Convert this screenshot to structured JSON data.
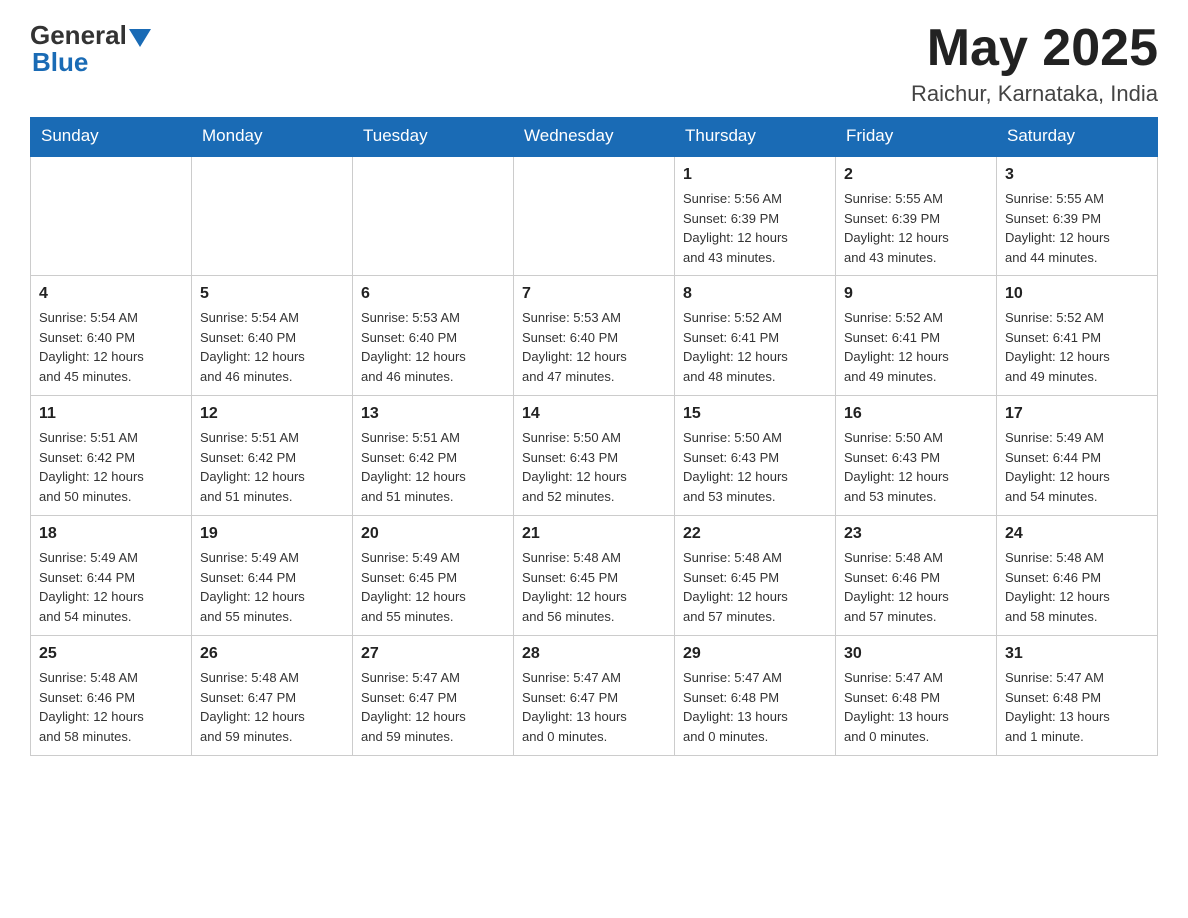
{
  "header": {
    "logo_general": "General",
    "logo_blue": "Blue",
    "month_title": "May 2025",
    "location": "Raichur, Karnataka, India"
  },
  "weekdays": [
    "Sunday",
    "Monday",
    "Tuesday",
    "Wednesday",
    "Thursday",
    "Friday",
    "Saturday"
  ],
  "weeks": [
    [
      {
        "day": "",
        "info": ""
      },
      {
        "day": "",
        "info": ""
      },
      {
        "day": "",
        "info": ""
      },
      {
        "day": "",
        "info": ""
      },
      {
        "day": "1",
        "info": "Sunrise: 5:56 AM\nSunset: 6:39 PM\nDaylight: 12 hours\nand 43 minutes."
      },
      {
        "day": "2",
        "info": "Sunrise: 5:55 AM\nSunset: 6:39 PM\nDaylight: 12 hours\nand 43 minutes."
      },
      {
        "day": "3",
        "info": "Sunrise: 5:55 AM\nSunset: 6:39 PM\nDaylight: 12 hours\nand 44 minutes."
      }
    ],
    [
      {
        "day": "4",
        "info": "Sunrise: 5:54 AM\nSunset: 6:40 PM\nDaylight: 12 hours\nand 45 minutes."
      },
      {
        "day": "5",
        "info": "Sunrise: 5:54 AM\nSunset: 6:40 PM\nDaylight: 12 hours\nand 46 minutes."
      },
      {
        "day": "6",
        "info": "Sunrise: 5:53 AM\nSunset: 6:40 PM\nDaylight: 12 hours\nand 46 minutes."
      },
      {
        "day": "7",
        "info": "Sunrise: 5:53 AM\nSunset: 6:40 PM\nDaylight: 12 hours\nand 47 minutes."
      },
      {
        "day": "8",
        "info": "Sunrise: 5:52 AM\nSunset: 6:41 PM\nDaylight: 12 hours\nand 48 minutes."
      },
      {
        "day": "9",
        "info": "Sunrise: 5:52 AM\nSunset: 6:41 PM\nDaylight: 12 hours\nand 49 minutes."
      },
      {
        "day": "10",
        "info": "Sunrise: 5:52 AM\nSunset: 6:41 PM\nDaylight: 12 hours\nand 49 minutes."
      }
    ],
    [
      {
        "day": "11",
        "info": "Sunrise: 5:51 AM\nSunset: 6:42 PM\nDaylight: 12 hours\nand 50 minutes."
      },
      {
        "day": "12",
        "info": "Sunrise: 5:51 AM\nSunset: 6:42 PM\nDaylight: 12 hours\nand 51 minutes."
      },
      {
        "day": "13",
        "info": "Sunrise: 5:51 AM\nSunset: 6:42 PM\nDaylight: 12 hours\nand 51 minutes."
      },
      {
        "day": "14",
        "info": "Sunrise: 5:50 AM\nSunset: 6:43 PM\nDaylight: 12 hours\nand 52 minutes."
      },
      {
        "day": "15",
        "info": "Sunrise: 5:50 AM\nSunset: 6:43 PM\nDaylight: 12 hours\nand 53 minutes."
      },
      {
        "day": "16",
        "info": "Sunrise: 5:50 AM\nSunset: 6:43 PM\nDaylight: 12 hours\nand 53 minutes."
      },
      {
        "day": "17",
        "info": "Sunrise: 5:49 AM\nSunset: 6:44 PM\nDaylight: 12 hours\nand 54 minutes."
      }
    ],
    [
      {
        "day": "18",
        "info": "Sunrise: 5:49 AM\nSunset: 6:44 PM\nDaylight: 12 hours\nand 54 minutes."
      },
      {
        "day": "19",
        "info": "Sunrise: 5:49 AM\nSunset: 6:44 PM\nDaylight: 12 hours\nand 55 minutes."
      },
      {
        "day": "20",
        "info": "Sunrise: 5:49 AM\nSunset: 6:45 PM\nDaylight: 12 hours\nand 55 minutes."
      },
      {
        "day": "21",
        "info": "Sunrise: 5:48 AM\nSunset: 6:45 PM\nDaylight: 12 hours\nand 56 minutes."
      },
      {
        "day": "22",
        "info": "Sunrise: 5:48 AM\nSunset: 6:45 PM\nDaylight: 12 hours\nand 57 minutes."
      },
      {
        "day": "23",
        "info": "Sunrise: 5:48 AM\nSunset: 6:46 PM\nDaylight: 12 hours\nand 57 minutes."
      },
      {
        "day": "24",
        "info": "Sunrise: 5:48 AM\nSunset: 6:46 PM\nDaylight: 12 hours\nand 58 minutes."
      }
    ],
    [
      {
        "day": "25",
        "info": "Sunrise: 5:48 AM\nSunset: 6:46 PM\nDaylight: 12 hours\nand 58 minutes."
      },
      {
        "day": "26",
        "info": "Sunrise: 5:48 AM\nSunset: 6:47 PM\nDaylight: 12 hours\nand 59 minutes."
      },
      {
        "day": "27",
        "info": "Sunrise: 5:47 AM\nSunset: 6:47 PM\nDaylight: 12 hours\nand 59 minutes."
      },
      {
        "day": "28",
        "info": "Sunrise: 5:47 AM\nSunset: 6:47 PM\nDaylight: 13 hours\nand 0 minutes."
      },
      {
        "day": "29",
        "info": "Sunrise: 5:47 AM\nSunset: 6:48 PM\nDaylight: 13 hours\nand 0 minutes."
      },
      {
        "day": "30",
        "info": "Sunrise: 5:47 AM\nSunset: 6:48 PM\nDaylight: 13 hours\nand 0 minutes."
      },
      {
        "day": "31",
        "info": "Sunrise: 5:47 AM\nSunset: 6:48 PM\nDaylight: 13 hours\nand 1 minute."
      }
    ]
  ]
}
